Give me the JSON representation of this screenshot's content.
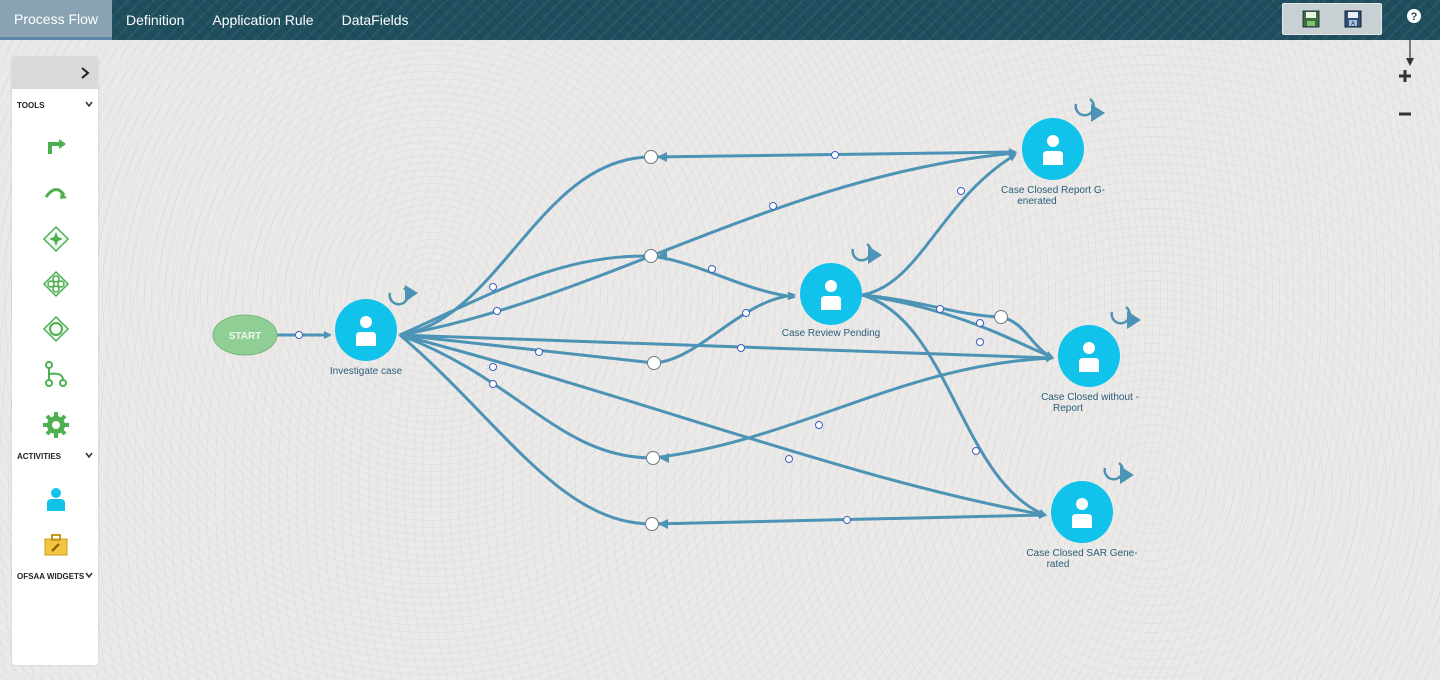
{
  "tabs": [
    {
      "label": "Process Flow",
      "active": true
    },
    {
      "label": "Definition",
      "active": false
    },
    {
      "label": "Application Rule",
      "active": false
    },
    {
      "label": "DataFields",
      "active": false
    }
  ],
  "palette": {
    "sections": {
      "tools": "TOOLS",
      "activities": "ACTIVITIES",
      "widgets": "OFSAA WIDGETS"
    },
    "tool_icons": [
      "connector-elbow-icon",
      "connector-curve-icon",
      "gateway-star-icon",
      "gateway-x-icon",
      "gateway-circle-icon",
      "branch-icon",
      "gear-icon"
    ],
    "activity_icons": [
      "human-task-icon",
      "toolbox-icon"
    ]
  },
  "nodes": {
    "start": "START",
    "investigate": "Investigate case",
    "review": "Case Review Pending",
    "report_l1": "Case Closed Report G-",
    "report_l2": "enerated",
    "without_l1": "Case Closed without -",
    "without_l2": "Report",
    "sar_l1": "Case Closed SAR Gene-",
    "sar_l2": "rated"
  },
  "colors": {
    "topbar": "#1f4f5e",
    "node": "#11c2eb",
    "edge": "#4c93b5",
    "start": "#8fcf96"
  }
}
